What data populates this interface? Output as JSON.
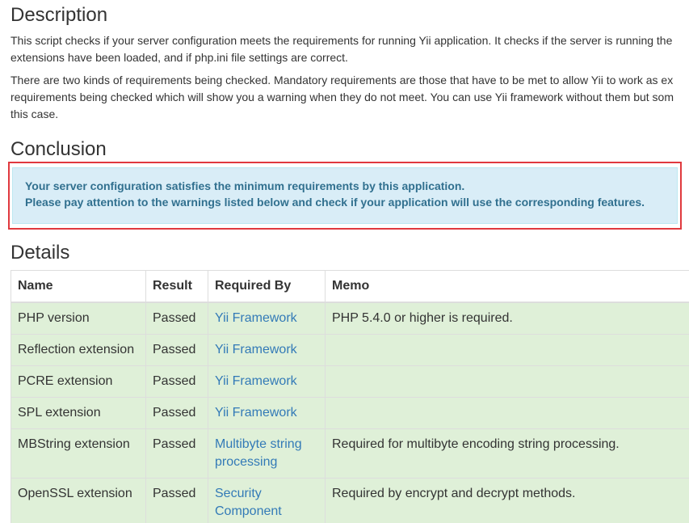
{
  "description": {
    "heading": "Description",
    "para1_line1": "This script checks if your server configuration meets the requirements for running Yii application. It checks if the server is running the",
    "para1_line2": "extensions have been loaded, and if php.ini file settings are correct.",
    "para2_line1": "There are two kinds of requirements being checked. Mandatory requirements are those that have to be met to allow Yii to work as ex",
    "para2_line2": "requirements being checked which will show you a warning when they do not meet. You can use Yii framework without them but som",
    "para2_line3": "this case."
  },
  "conclusion": {
    "heading": "Conclusion",
    "line1": "Your server configuration satisfies the minimum requirements by this application.",
    "line2": "Please pay attention to the warnings listed below and check if your application will use the corresponding features.",
    "highlight_color": "#e0393e",
    "info_bg": "#d9edf7",
    "info_text": "#31708f"
  },
  "details": {
    "heading": "Details",
    "columns": [
      "Name",
      "Result",
      "Required By",
      "Memo"
    ],
    "rows": [
      {
        "name": "PHP version",
        "result": "Passed",
        "required_by": "Yii Framework",
        "memo": "PHP 5.4.0 or higher is required."
      },
      {
        "name": "Reflection extension",
        "result": "Passed",
        "required_by": "Yii Framework",
        "memo": ""
      },
      {
        "name": "PCRE extension",
        "result": "Passed",
        "required_by": "Yii Framework",
        "memo": ""
      },
      {
        "name": "SPL extension",
        "result": "Passed",
        "required_by": "Yii Framework",
        "memo": ""
      },
      {
        "name": "MBString extension",
        "result": "Passed",
        "required_by": "Multibyte string processing",
        "memo": "Required for multibyte encoding string processing."
      },
      {
        "name": "OpenSSL extension",
        "result": "Passed",
        "required_by": "Security Component",
        "memo": "Required by encrypt and decrypt methods."
      }
    ],
    "row_success_bg": "#dff0d8",
    "link_color": "#337ab7"
  }
}
